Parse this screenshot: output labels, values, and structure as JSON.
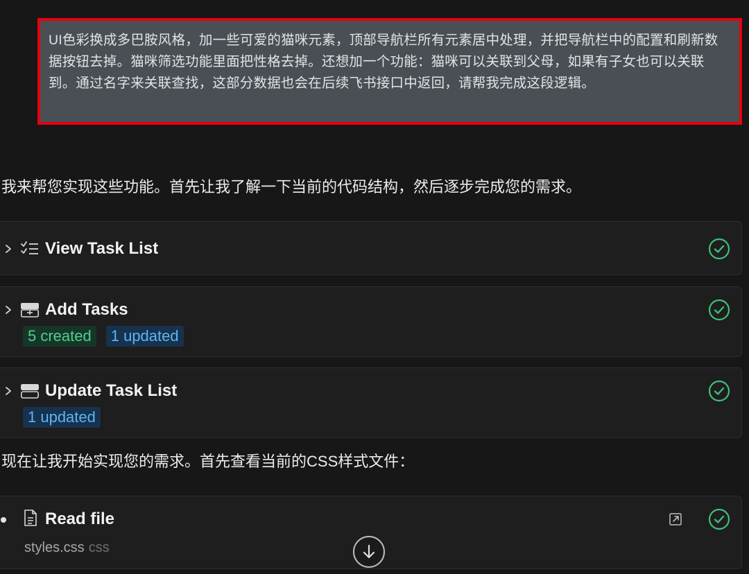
{
  "user_message": {
    "text": "UI色彩换成多巴胺风格，加一些可爱的猫咪元素，顶部导航栏所有元素居中处理，并把导航栏中的配置和刷新数据按钮去掉。猫咪筛选功能里面把性格去掉。还想加一个功能：猫咪可以关联到父母，如果有子女也可以关联到。通过名字来关联查找，这部分数据也会在后续飞书接口中返回，请帮我完成这段逻辑。"
  },
  "assistant": {
    "intro": "我来帮您实现这些功能。首先让我了解一下当前的代码结构，然后逐步完成您的需求。",
    "followup": "现在让我开始实现您的需求。首先查看当前的CSS样式文件："
  },
  "cards": {
    "view_task_list": {
      "title": "View Task List",
      "icon": "checklist-icon",
      "status": "completed"
    },
    "add_tasks": {
      "title": "Add Tasks",
      "icon": "tray-add-icon",
      "status": "completed",
      "badge_created": "5 created",
      "badge_updated": "1 updated"
    },
    "update_task_list": {
      "title": "Update Task List",
      "icon": "stack-icon",
      "status": "completed",
      "badge_updated": "1 updated"
    },
    "read_file": {
      "title": "Read file",
      "icon": "document-icon",
      "status": "completed",
      "file_name": "styles.css",
      "file_ext": "css"
    }
  },
  "colors": {
    "highlight_border": "#e8000e",
    "success": "#3fbf7a",
    "badge_green_text": "#4ed18a",
    "badge_blue_text": "#5fb4f5"
  }
}
